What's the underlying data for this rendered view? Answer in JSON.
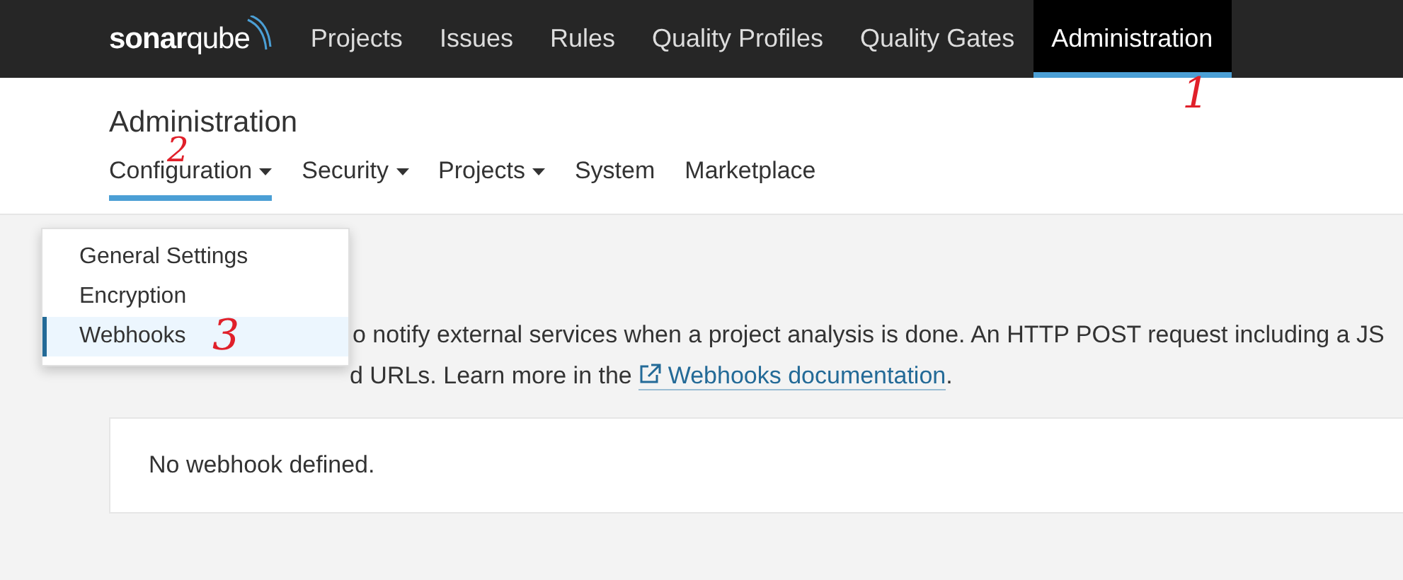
{
  "navbar": {
    "logo": "**sonar**qube",
    "items": [
      {
        "label": "Projects",
        "selected": false
      },
      {
        "label": "Issues",
        "selected": false
      },
      {
        "label": "Rules",
        "selected": false
      },
      {
        "label": "Quality Profiles",
        "selected": false
      },
      {
        "label": "Quality Gates",
        "selected": false
      },
      {
        "label": "Administration",
        "selected": true
      }
    ]
  },
  "page": {
    "title": "Administration",
    "tabs": [
      {
        "label": "Configuration",
        "dropdown": true,
        "selected": true
      },
      {
        "label": "Security",
        "dropdown": true,
        "selected": false
      },
      {
        "label": "Projects",
        "dropdown": true,
        "selected": false
      },
      {
        "label": "System",
        "dropdown": false,
        "selected": false
      },
      {
        "label": "Marketplace",
        "dropdown": false,
        "selected": false
      }
    ]
  },
  "dropdown": {
    "items": [
      {
        "label": "General Settings",
        "selected": false
      },
      {
        "label": "Encryption",
        "selected": false
      },
      {
        "label": "Webhooks",
        "selected": true
      }
    ]
  },
  "description": {
    "line_1": "o notify external services when a project analysis is done. An HTTP POST request including a JS",
    "line_2": "d URLs. Learn more in the",
    "link": "Webhooks documentation",
    "end": "."
  },
  "empty_card": {
    "text": "No webhook defined."
  },
  "annotations": [
    "1",
    "2",
    "3"
  ]
}
